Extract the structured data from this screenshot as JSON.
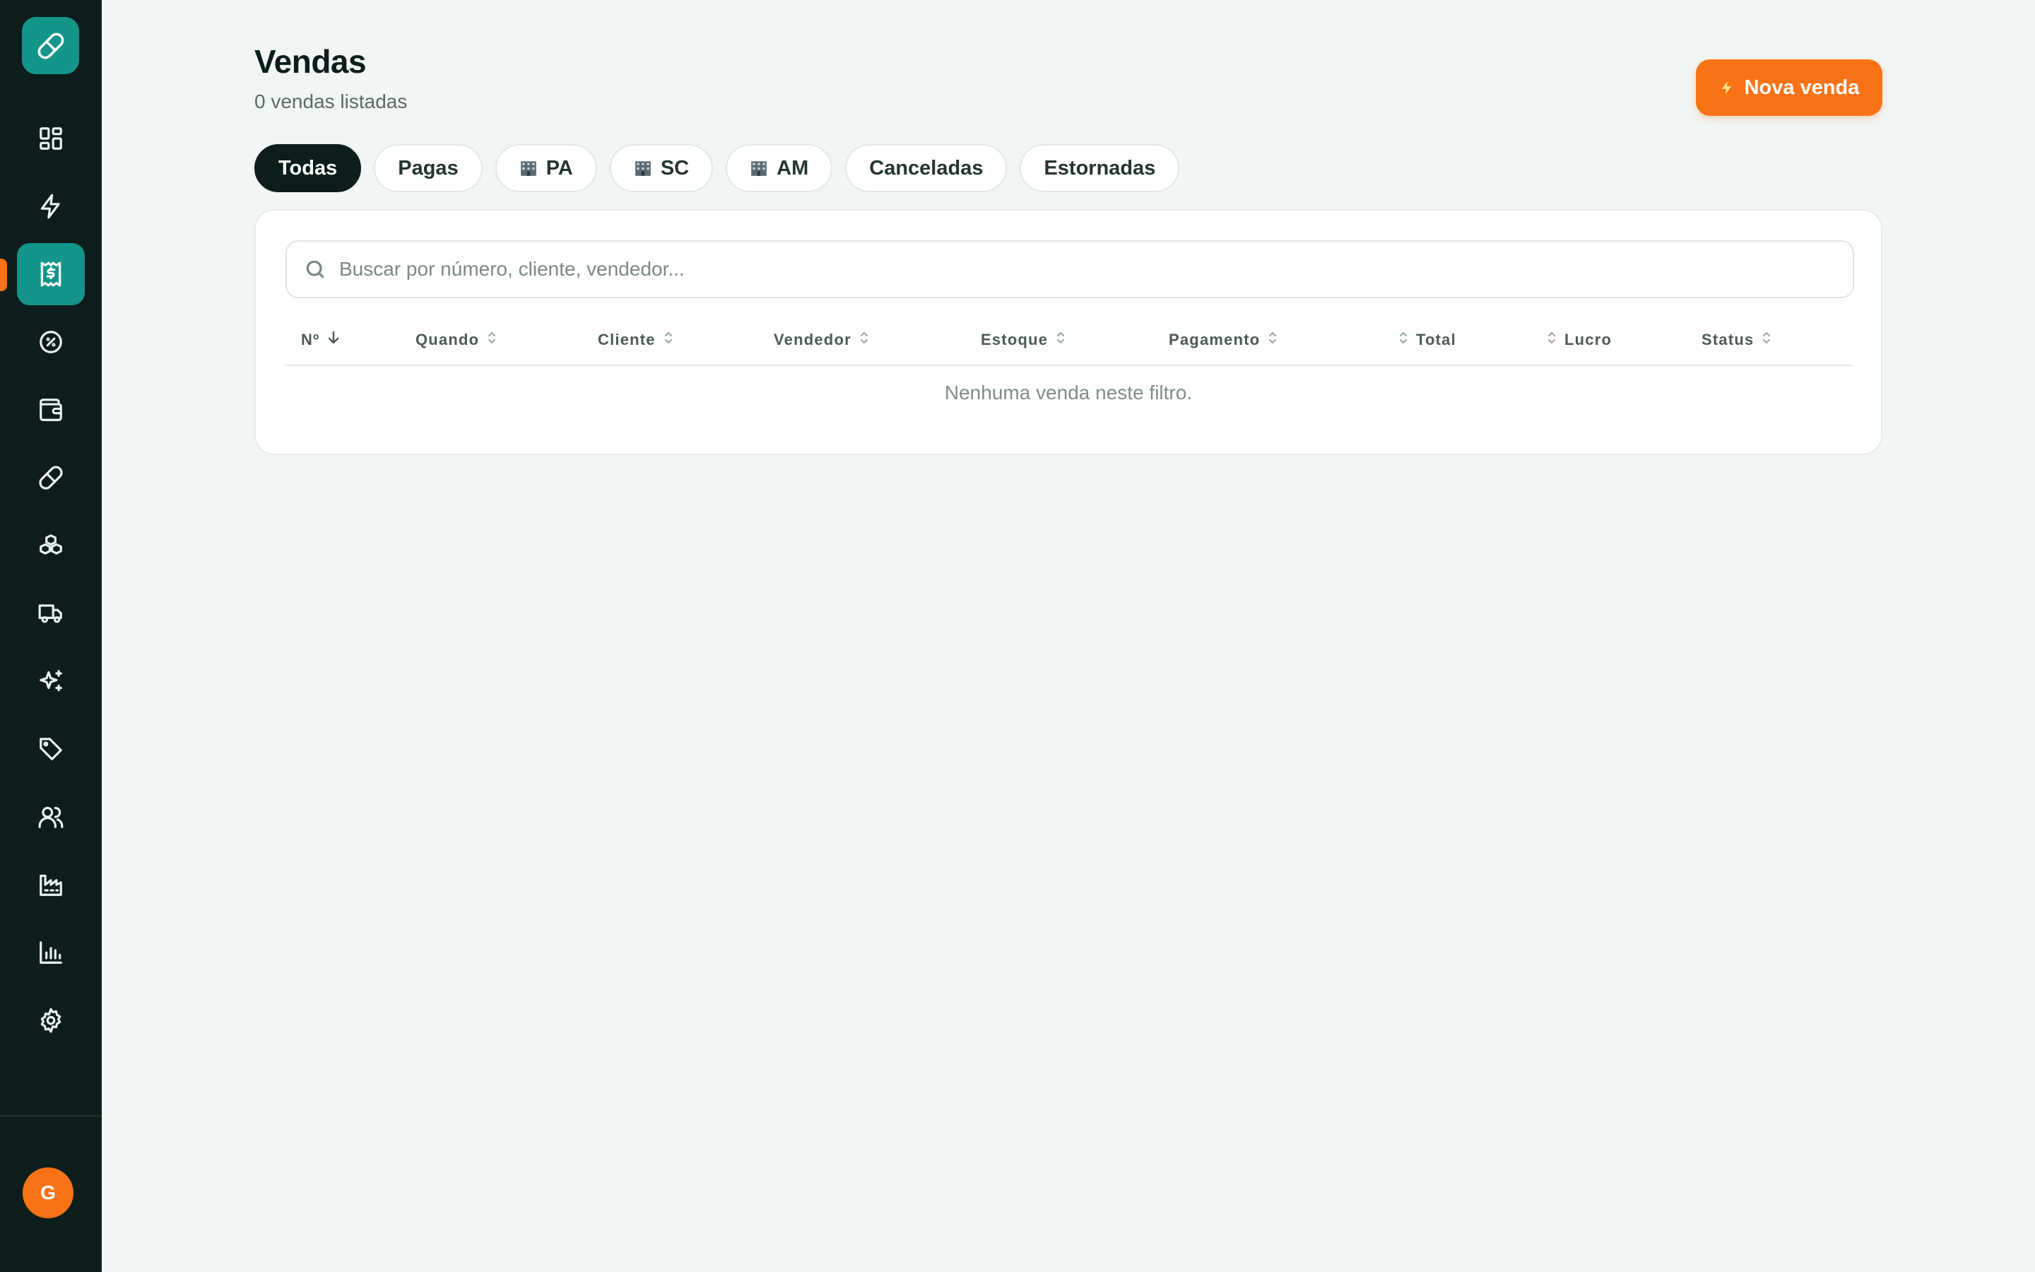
{
  "sidebar": {
    "logo_icon": "pill-icon",
    "items": [
      {
        "name": "dashboard",
        "icon": "grid-icon"
      },
      {
        "name": "quick-sale",
        "icon": "bolt-icon"
      },
      {
        "name": "sales",
        "icon": "receipt-dollar-icon",
        "active": true
      },
      {
        "name": "discounts",
        "icon": "badge-percent-icon"
      },
      {
        "name": "wallet",
        "icon": "wallet-icon"
      },
      {
        "name": "medicines",
        "icon": "pill-icon"
      },
      {
        "name": "stock",
        "icon": "boxes-icon"
      },
      {
        "name": "delivery",
        "icon": "truck-icon"
      },
      {
        "name": "ai",
        "icon": "sparkles-icon"
      },
      {
        "name": "tags",
        "icon": "tag-icon"
      },
      {
        "name": "customers",
        "icon": "users-icon"
      },
      {
        "name": "suppliers",
        "icon": "factory-icon"
      },
      {
        "name": "reports",
        "icon": "bar-chart-icon"
      },
      {
        "name": "settings",
        "icon": "gear-icon"
      }
    ],
    "avatar_initial": "G"
  },
  "header": {
    "title": "Vendas",
    "subtitle": "0 vendas listadas",
    "new_sale_label": "Nova venda"
  },
  "filters": [
    {
      "label": "Todas",
      "active": true
    },
    {
      "label": "Pagas"
    },
    {
      "label": "PA",
      "icon": "building-icon"
    },
    {
      "label": "SC",
      "icon": "building-icon"
    },
    {
      "label": "AM",
      "icon": "building-icon"
    },
    {
      "label": "Canceladas"
    },
    {
      "label": "Estornadas"
    }
  ],
  "search": {
    "placeholder": "Buscar por número, cliente, vendedor..."
  },
  "table": {
    "columns": {
      "numero": "Nº",
      "quando": "Quando",
      "cliente": "Cliente",
      "vendedor": "Vendedor",
      "estoque": "Estoque",
      "pagamento": "Pagamento",
      "total": "Total",
      "lucro": "Lucro",
      "status": "Status"
    },
    "empty_message": "Nenhuma venda neste filtro."
  },
  "colors": {
    "sidebar_bg": "#0c1d1b",
    "accent_teal": "#14958a",
    "accent_orange": "#f97316",
    "page_bg": "#f1f5f4"
  }
}
